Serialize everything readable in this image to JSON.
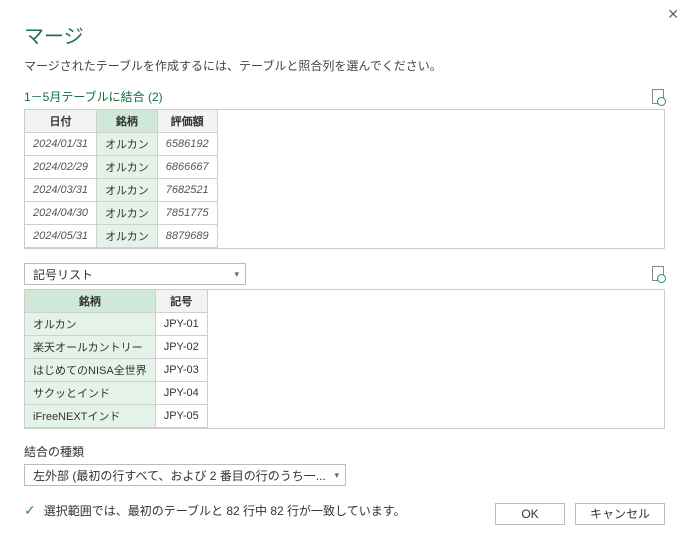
{
  "window": {
    "title": "マージ",
    "subtitle": "マージされたテーブルを作成するには、テーブルと照合列を選んでください。"
  },
  "table1": {
    "caption": "1－5月テーブルに結合 (2)",
    "headers": {
      "c0": "日付",
      "c1": "銘柄",
      "c2": "評価額"
    },
    "rows": [
      {
        "c0": "2024/01/31",
        "c1": "オルカン",
        "c2": "6586192"
      },
      {
        "c0": "2024/02/29",
        "c1": "オルカン",
        "c2": "6866667"
      },
      {
        "c0": "2024/03/31",
        "c1": "オルカン",
        "c2": "7682521"
      },
      {
        "c0": "2024/04/30",
        "c1": "オルカン",
        "c2": "7851775"
      },
      {
        "c0": "2024/05/31",
        "c1": "オルカン",
        "c2": "8879689"
      }
    ]
  },
  "table2": {
    "dropdown_label": "記号リスト",
    "headers": {
      "c0": "銘柄",
      "c1": "記号"
    },
    "rows": [
      {
        "c0": "オルカン",
        "c1": "JPY-01"
      },
      {
        "c0": "楽天オールカントリー",
        "c1": "JPY-02"
      },
      {
        "c0": "はじめてのNISA全世界",
        "c1": "JPY-03"
      },
      {
        "c0": "サクッとインド",
        "c1": "JPY-04"
      },
      {
        "c0": "iFreeNEXTインド",
        "c1": "JPY-05"
      }
    ]
  },
  "join": {
    "label": "結合の種類",
    "value": "左外部 (最初の行すべて、および 2 番目の行のうち一..."
  },
  "status": "選択範囲では、最初のテーブルと 82 行中 82 行が一致しています。",
  "buttons": {
    "ok": "OK",
    "cancel": "キャンセル"
  }
}
